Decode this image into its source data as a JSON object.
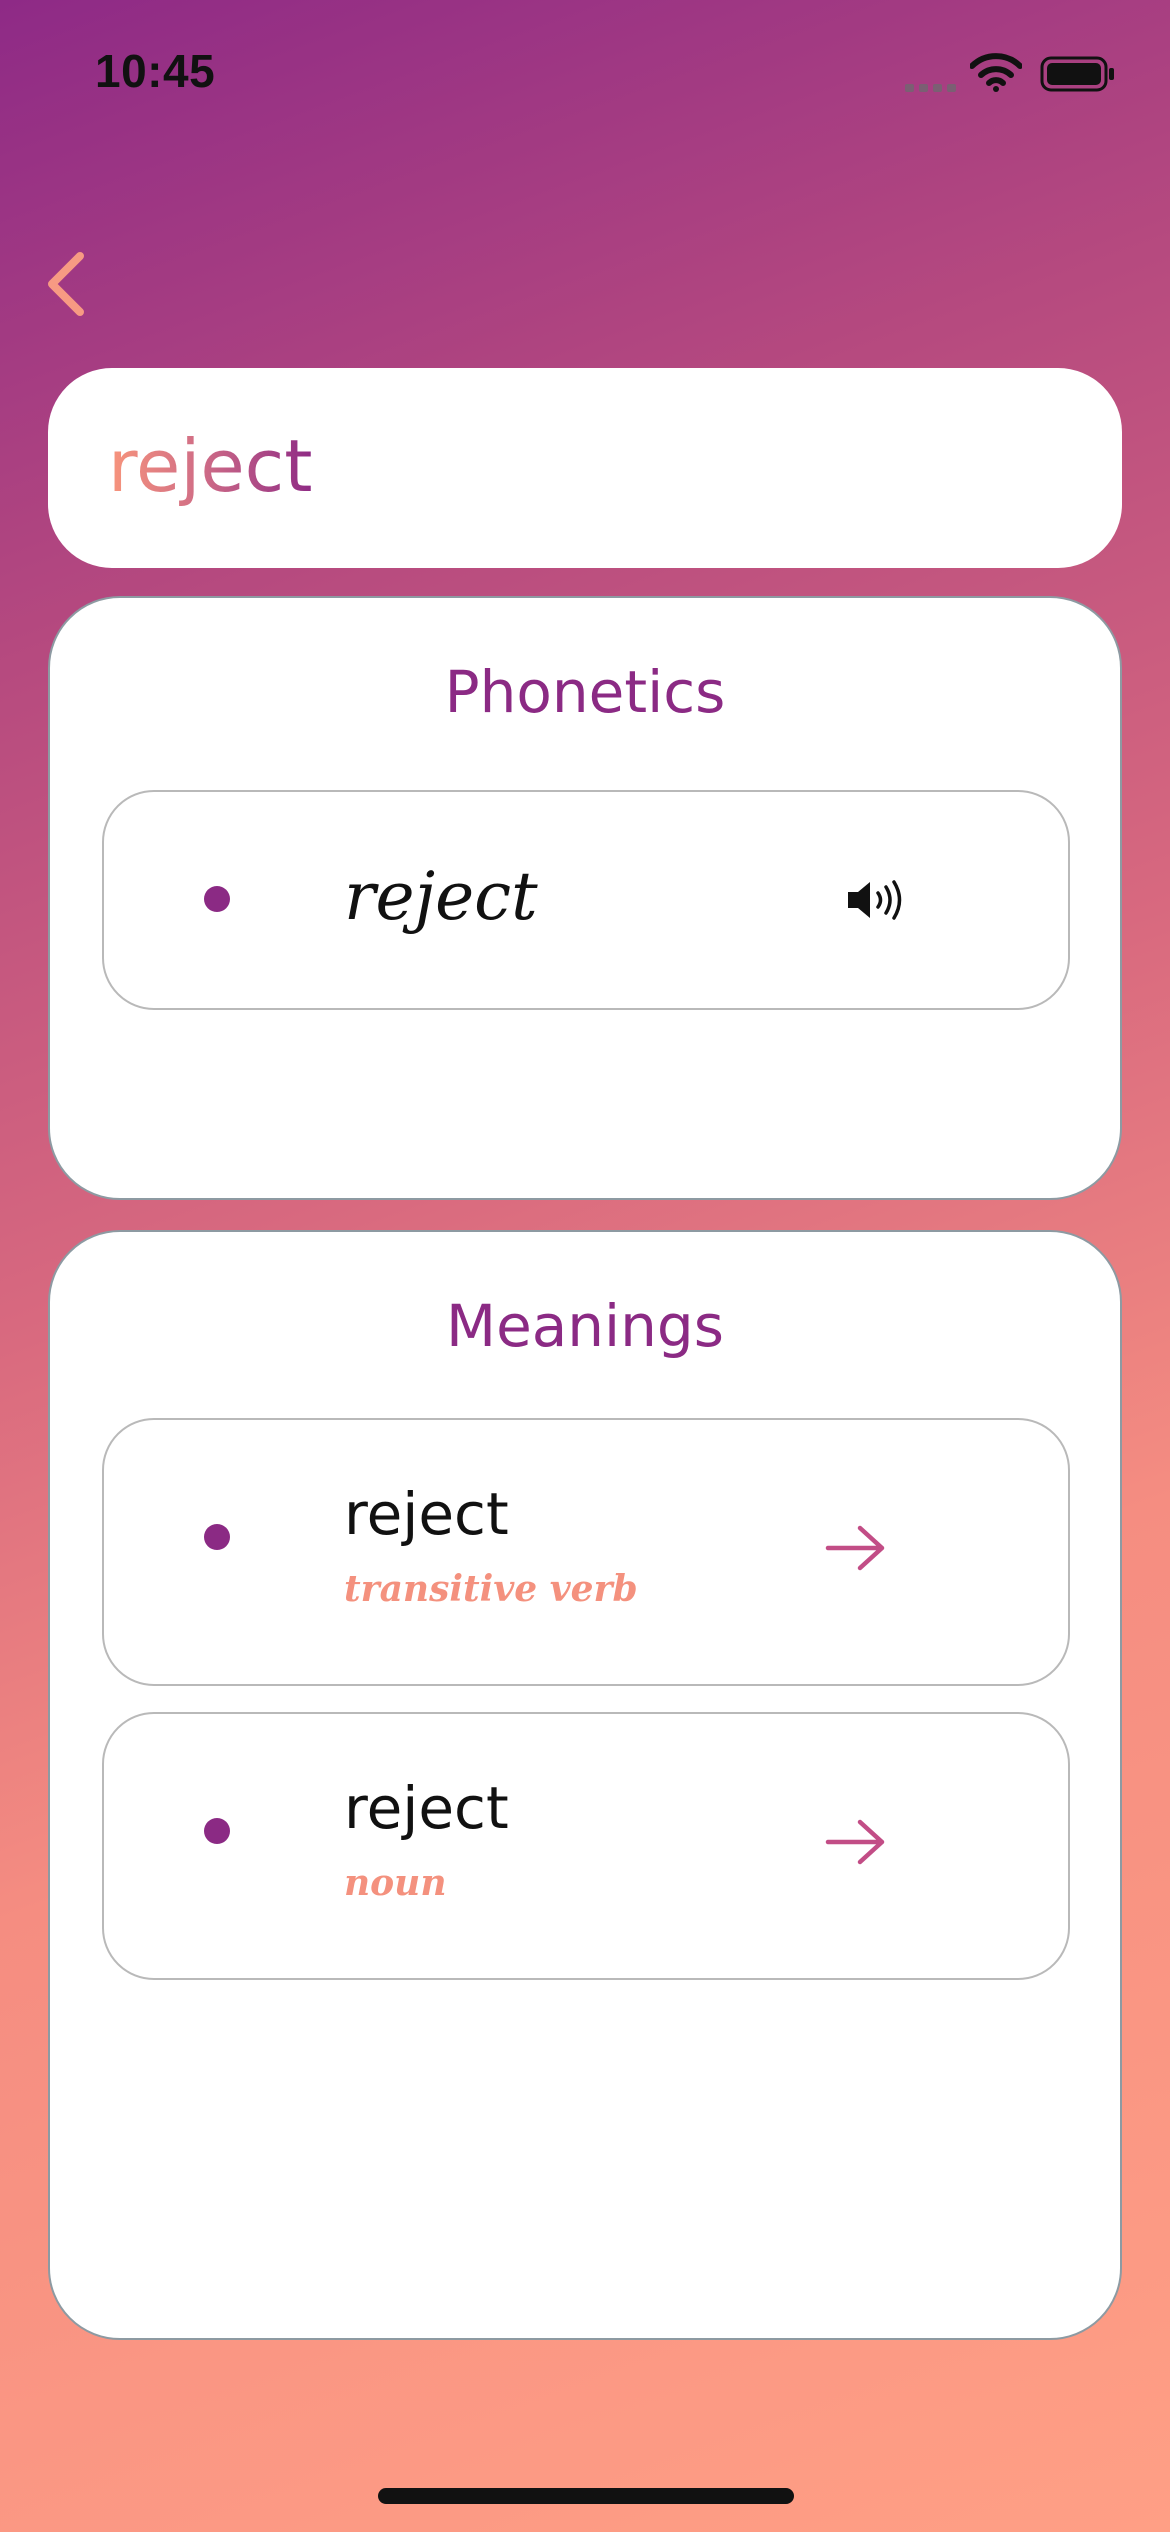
{
  "status_bar": {
    "time": "10:45",
    "icons": [
      "cellular-signal-icon",
      "wifi-icon",
      "battery-icon"
    ]
  },
  "nav": {
    "back_icon": "chevron-left-icon",
    "accent_color": "#f79a83"
  },
  "search": {
    "word": "reject"
  },
  "phonetics": {
    "title": "Phonetics",
    "items": [
      {
        "text": "reject",
        "audio_icon": "speaker-icon"
      }
    ]
  },
  "meanings": {
    "title": "Meanings",
    "items": [
      {
        "word": "reject",
        "part_of_speech": "transitive verb",
        "action_icon": "arrow-right-icon"
      },
      {
        "word": "reject",
        "part_of_speech": "noun",
        "action_icon": "arrow-right-icon"
      }
    ]
  },
  "colors": {
    "primary": "#8b2a84",
    "secondary": "#f4917e",
    "gradient_top": "#8e2a86",
    "gradient_bottom": "#ff9f85"
  }
}
